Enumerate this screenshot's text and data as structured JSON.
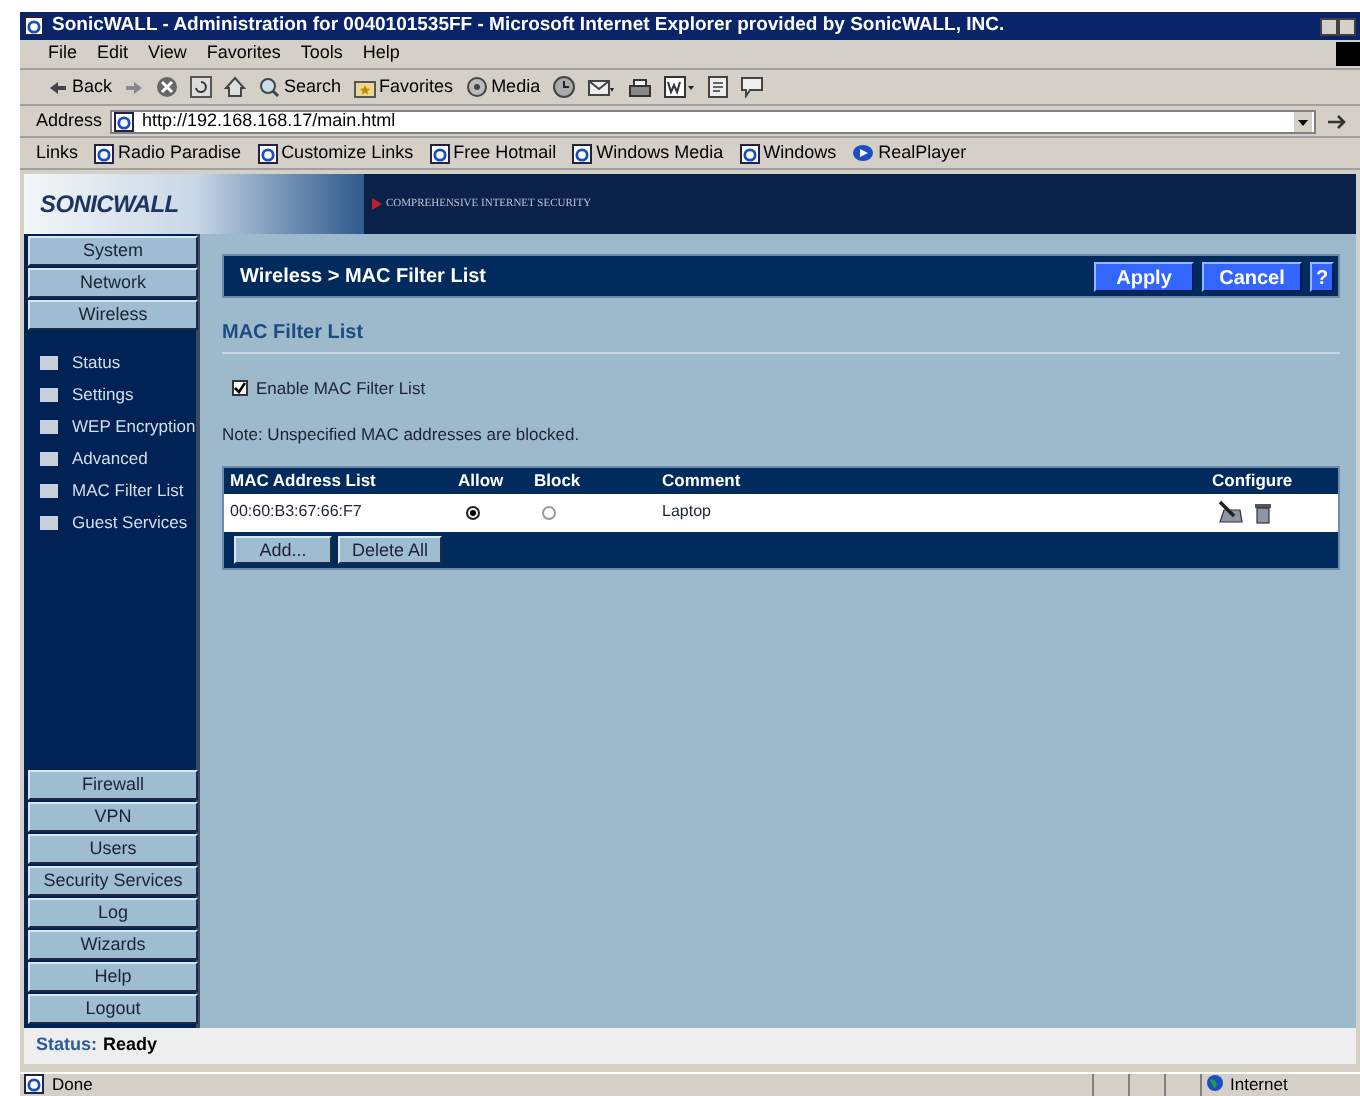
{
  "window": {
    "title": "SonicWALL - Administration for 0040101535FF - Microsoft Internet Explorer provided by SonicWALL, INC."
  },
  "menu": [
    "File",
    "Edit",
    "View",
    "Favorites",
    "Tools",
    "Help"
  ],
  "toolbar": [
    {
      "kind": "back",
      "label": "Back"
    },
    {
      "kind": "forward"
    },
    {
      "kind": "stop"
    },
    {
      "kind": "refresh"
    },
    {
      "kind": "home"
    },
    {
      "kind": "search",
      "label": "Search"
    },
    {
      "kind": "favorites",
      "label": "Favorites"
    },
    {
      "kind": "media",
      "label": "Media"
    },
    {
      "kind": "history"
    },
    {
      "kind": "mail"
    },
    {
      "kind": "print"
    },
    {
      "kind": "word"
    },
    {
      "kind": "edit"
    },
    {
      "kind": "discuss"
    }
  ],
  "address": {
    "label": "Address",
    "value": "http://192.168.168.17/main.html"
  },
  "links": {
    "label": "Links",
    "items": [
      {
        "kind": "ie",
        "label": "Radio Paradise"
      },
      {
        "kind": "ie",
        "label": "Customize Links"
      },
      {
        "kind": "ie",
        "label": "Free Hotmail"
      },
      {
        "kind": "ie",
        "label": "Windows Media"
      },
      {
        "kind": "ie",
        "label": "Windows"
      },
      {
        "kind": "real",
        "label": "RealPlayer"
      }
    ]
  },
  "banner": {
    "logo": "SONICWALL",
    "tagline": "COMPREHENSIVE INTERNET SECURITY"
  },
  "sidebar": {
    "top_items": [
      "System",
      "Network",
      "Wireless"
    ],
    "sub_items": [
      "Status",
      "Settings",
      "WEP Encryption",
      "Advanced",
      "MAC Filter List",
      "Guest Services"
    ],
    "bottom_items": [
      "Firewall",
      "VPN",
      "Users",
      "Security Services",
      "Log",
      "Wizards",
      "Help",
      "Logout"
    ]
  },
  "header": {
    "title": "Wireless > MAC Filter List",
    "buttons": [
      "Apply",
      "Cancel",
      "?"
    ]
  },
  "section_title": "MAC Filter List",
  "enable_checkbox": {
    "label": "Enable MAC Filter List",
    "checked": true
  },
  "note": "Note: Unspecified MAC addresses are blocked.",
  "table": {
    "columns": [
      "MAC Address List",
      "Allow",
      "Block",
      "Comment",
      "Configure"
    ],
    "rows": [
      {
        "mac": "00:60:B3:67:66:F7",
        "options": [
          {
            "selected": true
          },
          {
            "selected": false
          }
        ],
        "comment": "Laptop"
      }
    ],
    "buttons": [
      "Add...",
      "Delete All"
    ]
  },
  "status": {
    "label": "Status:",
    "value": "Ready"
  },
  "browser_status": {
    "text": "Done",
    "zone": "Internet"
  }
}
